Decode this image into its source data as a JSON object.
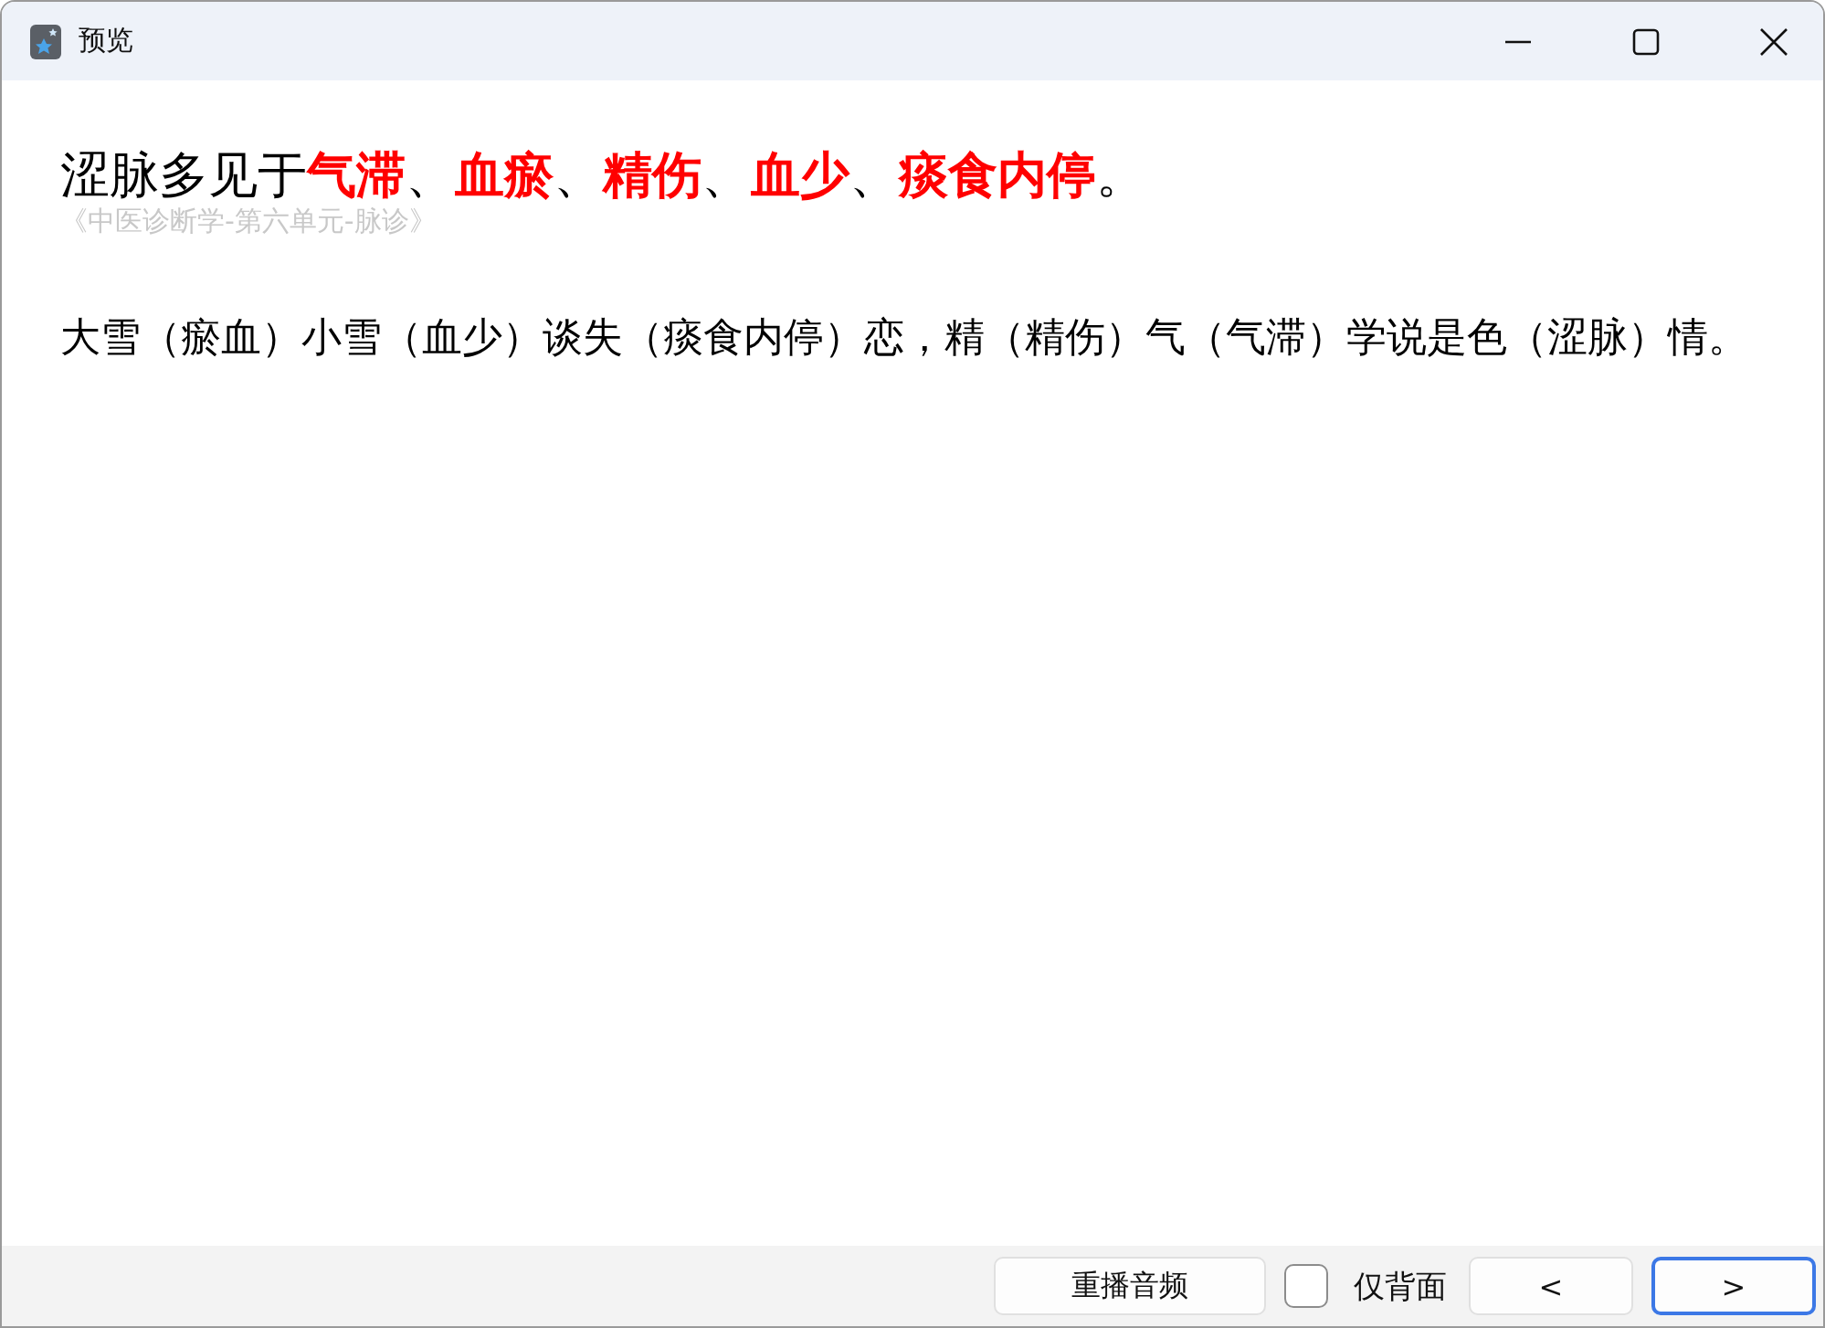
{
  "window": {
    "title": "预览"
  },
  "heading": [
    {
      "text": "涩脉多见于",
      "highlight": false
    },
    {
      "text": "气滞",
      "highlight": true
    },
    {
      "text": "、",
      "highlight": false
    },
    {
      "text": "血瘀",
      "highlight": true
    },
    {
      "text": "、",
      "highlight": false
    },
    {
      "text": "精伤",
      "highlight": true
    },
    {
      "text": "、",
      "highlight": false
    },
    {
      "text": "血少",
      "highlight": true
    },
    {
      "text": "、",
      "highlight": false
    },
    {
      "text": "痰食内停",
      "highlight": true
    },
    {
      "text": "。",
      "highlight": false
    }
  ],
  "source": "《中医诊断学-第六单元-脉诊》",
  "mnemonic": "大雪（瘀血）小雪（血少）谈失（痰食内停）恋，精（精伤）气（气滞）学说是色（涩脉）情。",
  "footer": {
    "replay_button": "重播音频",
    "back_only": {
      "label": "仅背面",
      "checked": false
    },
    "prev_button": "<",
    "next_button": ">"
  }
}
